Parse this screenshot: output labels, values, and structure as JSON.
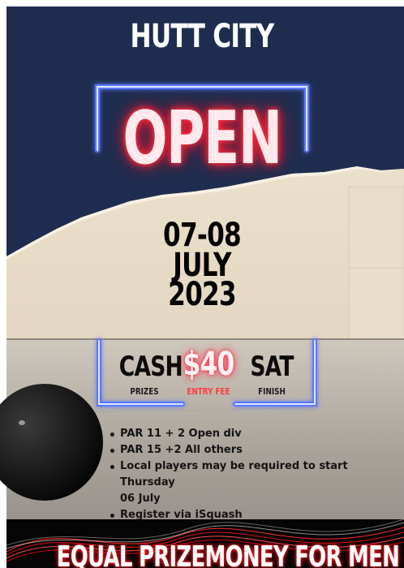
{
  "poster": {
    "title": "HUTT CITY",
    "headline": "OPEN",
    "date": {
      "line1": "07-08",
      "line2": "JULY",
      "line3": "2023"
    },
    "stats": [
      {
        "value": "CASH",
        "label": "PRIZES"
      },
      {
        "value": "$40",
        "label": "ENTRY FEE"
      },
      {
        "value": "SAT",
        "label": "FINISH"
      }
    ],
    "bullets": [
      "PAR 11 + 2 Open div",
      "PAR 15 +2 All others",
      "Local players may be required to start Thursday",
      "06 July",
      "Register via iSquash"
    ],
    "banner": "EQUAL PRIZEMONEY FOR MEN & WOMEN"
  },
  "colors": {
    "navy": "#1e2d4f",
    "neon_blue": "#4a6bff",
    "neon_red": "#ff2a3d",
    "beige": "#ece1cc",
    "floor": "#b9b3ab"
  }
}
